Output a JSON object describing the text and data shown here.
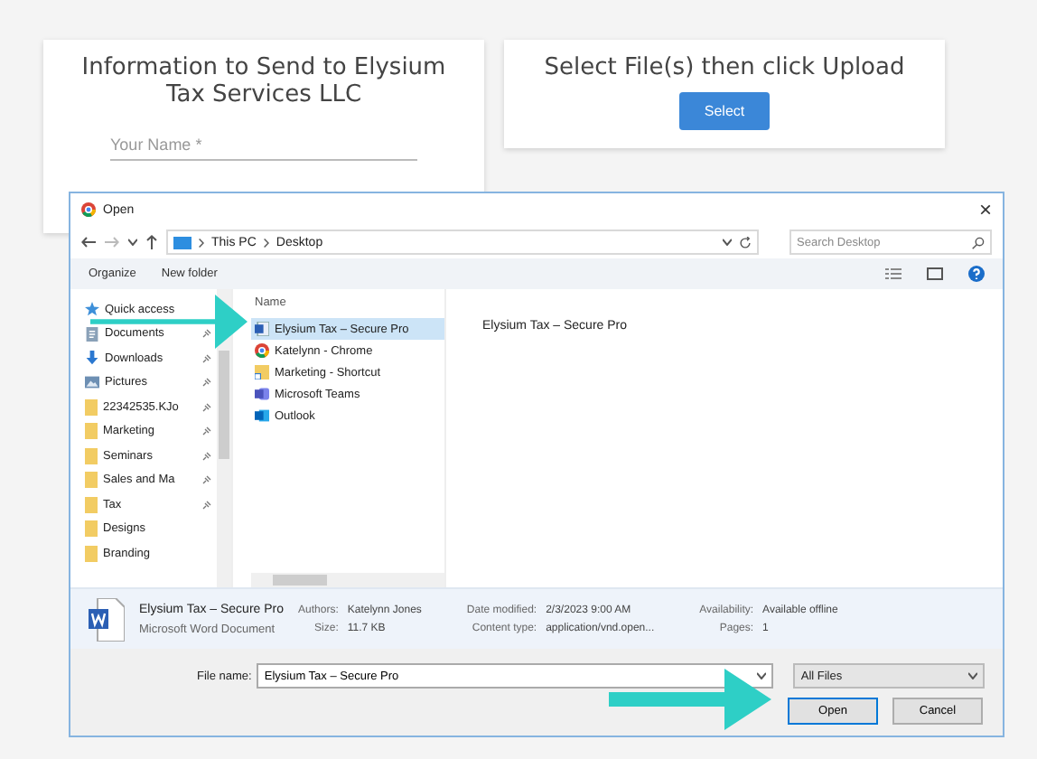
{
  "info_card": {
    "title": "Information to Send to Elysium Tax Services LLC",
    "name_field": {
      "placeholder": "Your Name *"
    }
  },
  "upload_card": {
    "title": "Select File(s) then click Upload",
    "button": "Select"
  },
  "dialog": {
    "title": "Open",
    "close": "×",
    "path": [
      "This PC",
      "Desktop"
    ],
    "search": {
      "placeholder": "Search Desktop"
    },
    "toolbar": {
      "organize": "Organize",
      "new_folder": "New folder"
    },
    "nav_items": [
      {
        "label": "Quick access",
        "kind": "star",
        "pinned": false
      },
      {
        "label": "Documents",
        "kind": "documents",
        "pinned": true
      },
      {
        "label": "Downloads",
        "kind": "downloads",
        "pinned": true
      },
      {
        "label": "Pictures",
        "kind": "pictures",
        "pinned": true
      },
      {
        "label": "22342535.KJo",
        "kind": "folder",
        "pinned": true
      },
      {
        "label": "Marketing",
        "kind": "folder",
        "pinned": true
      },
      {
        "label": "Seminars",
        "kind": "folder",
        "pinned": true
      },
      {
        "label": "Sales and Ma",
        "kind": "folder",
        "pinned": true
      },
      {
        "label": "Tax",
        "kind": "folder",
        "pinned": true
      },
      {
        "label": "Designs",
        "kind": "folder",
        "pinned": false
      },
      {
        "label": "Branding",
        "kind": "folder",
        "pinned": false
      }
    ],
    "column_header": "Name",
    "files": [
      {
        "name": "Elysium Tax – Secure Pro",
        "kind": "word",
        "selected": true
      },
      {
        "name": "Katelynn - Chrome",
        "kind": "chrome",
        "selected": false
      },
      {
        "name": "Marketing - Shortcut",
        "kind": "shortcut",
        "selected": false
      },
      {
        "name": "Microsoft Teams",
        "kind": "teams",
        "selected": false
      },
      {
        "name": "Outlook",
        "kind": "outlook",
        "selected": false
      }
    ],
    "preview_text": "Elysium Tax – Secure Pro",
    "details": {
      "name": "Elysium Tax – Secure Pro",
      "type": "Microsoft Word Document",
      "fields": [
        {
          "label": "Authors:",
          "value": "Katelynn Jones"
        },
        {
          "label": "Size:",
          "value": "11.7 KB"
        },
        {
          "label": "Date modified:",
          "value": "2/3/2023 9:00 AM"
        },
        {
          "label": "Content type:",
          "value": "application/vnd.open..."
        },
        {
          "label": "Availability:",
          "value": "Available offline"
        },
        {
          "label": "Pages:",
          "value": "1"
        }
      ]
    },
    "file_name": {
      "label": "File name:",
      "value": "Elysium Tax – Secure Pro"
    },
    "file_type": "All Files",
    "buttons": [
      {
        "label": "Open",
        "default": true
      },
      {
        "label": "Cancel",
        "default": false
      }
    ]
  }
}
